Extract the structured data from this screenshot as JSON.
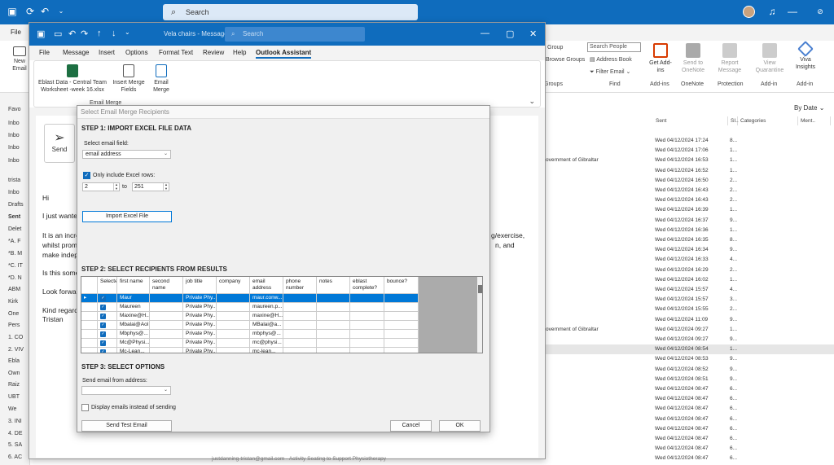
{
  "app": {
    "search_placeholder": "Search",
    "menu_file": "File"
  },
  "main_ribbon": {
    "new_email": "New Email",
    "group": "Group",
    "browse_groups": "Browse Groups",
    "groups_label": "Groups",
    "search_people": "Search People",
    "address_book": "Address Book",
    "filter_email": "Filter Email",
    "find_label": "Find",
    "get_addins": "Get Add-ins",
    "addins_label": "Add-ins",
    "send_to_onenote": "Send to OneNote",
    "onenote_label": "OneNote",
    "report_message": "Report Message",
    "protection_label": "Protection",
    "view_quarantine": "View Quarantine",
    "addin_label": "Add-in",
    "viva_insights": "Viva Insights",
    "addin2_label": "Add-in"
  },
  "left_pane": {
    "items": [
      "Favo",
      "Inbo",
      "Inbo",
      "Inbo",
      "Inbo",
      "trista",
      "Inbo",
      "Drafts",
      "Sent",
      "Delet",
      "*A. F",
      "*B. M",
      "*C. IT",
      "*D. N",
      "ABM",
      "Kirk",
      "One",
      "Pers",
      "1. CO",
      "2. VIV",
      "Ebla",
      "Own",
      "Raiz",
      "UBT",
      "We",
      "3. INI",
      "4. DE",
      "5. SA",
      "6. AC",
      "7. CO"
    ]
  },
  "mail_list": {
    "sort": "By Date",
    "columns": [
      "Sent",
      "SI..",
      "Categories",
      "Ment.."
    ],
    "rows": [
      {
        "from": "",
        "date": "Wed 04/12/2024 17:24",
        "size": "8..."
      },
      {
        "from": "",
        "date": "Wed 04/12/2024 17:06",
        "size": "1..."
      },
      {
        "from": "overnment of Gibraltar",
        "date": "Wed 04/12/2024 16:53",
        "size": "1..."
      },
      {
        "from": "",
        "date": "Wed 04/12/2024 16:52",
        "size": "1..."
      },
      {
        "from": "",
        "date": "Wed 04/12/2024 16:50",
        "size": "2..."
      },
      {
        "from": "",
        "date": "Wed 04/12/2024 16:43",
        "size": "2..."
      },
      {
        "from": "",
        "date": "Wed 04/12/2024 16:43",
        "size": "2..."
      },
      {
        "from": "",
        "date": "Wed 04/12/2024 16:39",
        "size": "1..."
      },
      {
        "from": "",
        "date": "Wed 04/12/2024 16:37",
        "size": "9..."
      },
      {
        "from": "",
        "date": "Wed 04/12/2024 16:36",
        "size": "1..."
      },
      {
        "from": "",
        "date": "Wed 04/12/2024 16:35",
        "size": "8..."
      },
      {
        "from": "",
        "date": "Wed 04/12/2024 16:34",
        "size": "9..."
      },
      {
        "from": "",
        "date": "Wed 04/12/2024 16:33",
        "size": "4..."
      },
      {
        "from": "",
        "date": "Wed 04/12/2024 16:29",
        "size": "2..."
      },
      {
        "from": "",
        "date": "Wed 04/12/2024 16:02",
        "size": "1..."
      },
      {
        "from": "",
        "date": "Wed 04/12/2024 15:57",
        "size": "4..."
      },
      {
        "from": "",
        "date": "Wed 04/12/2024 15:57",
        "size": "3..."
      },
      {
        "from": "",
        "date": "Wed 04/12/2024 15:55",
        "size": "2..."
      },
      {
        "from": "",
        "date": "Wed 04/12/2024 11:09",
        "size": "9..."
      },
      {
        "from": "overnment of Gibraltar",
        "date": "Wed 04/12/2024 09:27",
        "size": "1..."
      },
      {
        "from": "",
        "date": "Wed 04/12/2024 09:27",
        "size": "9..."
      },
      {
        "from": "",
        "date": "Wed 04/12/2024 08:54",
        "size": "1..."
      },
      {
        "from": "",
        "date": "Wed 04/12/2024 08:53",
        "size": "9..."
      },
      {
        "from": "",
        "date": "Wed 04/12/2024 08:52",
        "size": "9..."
      },
      {
        "from": "",
        "date": "Wed 04/12/2024 08:51",
        "size": "9..."
      },
      {
        "from": "",
        "date": "Wed 04/12/2024 08:47",
        "size": "6..."
      },
      {
        "from": "",
        "date": "Wed 04/12/2024 08:47",
        "size": "6..."
      },
      {
        "from": "",
        "date": "Wed 04/12/2024 08:47",
        "size": "6..."
      },
      {
        "from": "",
        "date": "Wed 04/12/2024 08:47",
        "size": "6..."
      },
      {
        "from": "",
        "date": "Wed 04/12/2024 08:47",
        "size": "6..."
      },
      {
        "from": "",
        "date": "Wed 04/12/2024 08:47",
        "size": "6..."
      },
      {
        "from": "",
        "date": "Wed 04/12/2024 08:47",
        "size": "6..."
      },
      {
        "from": "",
        "date": "Wed 04/12/2024 08:47",
        "size": "6..."
      },
      {
        "from": "",
        "date": "Wed 04/12/2024 08:47",
        "size": "6..."
      },
      {
        "from": "",
        "date": "Wed 04/12/2024 08:47",
        "size": "6..."
      }
    ]
  },
  "message": {
    "title": "Vela chairs - Message (H...",
    "search_placeholder": "Search",
    "tabs": [
      "File",
      "Message",
      "Insert",
      "Options",
      "Format Text",
      "Review",
      "Help",
      "Outlook Assistant"
    ],
    "ribbon": {
      "eblast_data": "Eblast Data - Central Team Worksheet -week 16.xlsx",
      "insert_merge_fields": "Insert Merge Fields",
      "email_merge": "Email Merge",
      "group_label": "Email Merge"
    },
    "send": "Send",
    "body": {
      "greeting": "Hi",
      "line1": "I just wante",
      "line2": "It is an incre",
      "line2_right": "g/exercise,",
      "line3": "whilst prom",
      "line3_right": "n, and",
      "line4": "make indep",
      "line5": "Is this some",
      "line6": "Look forwa",
      "line7": "Kind regard",
      "line8": "Tristan",
      "footer": "justdanning-tristan@gmail.com - Activity Seating to Support Physiotherapy"
    }
  },
  "dialog": {
    "title": "Select Email Merge Recipients",
    "step1": "STEP 1: IMPORT EXCEL FILE DATA",
    "select_email_field": "Select email field:",
    "email_field_value": "email address",
    "only_include": "Only include Excel rows:",
    "row_from": "2",
    "to_label": "to",
    "row_to": "251",
    "import_button": "Import Excel File",
    "step2": "STEP 2: SELECT RECIPIENTS FROM RESULTS",
    "grid": {
      "headers": [
        "Selecte",
        "first name",
        "second name",
        "job title",
        "company",
        "email address",
        "phone number",
        "notes",
        "eblast complete?",
        "bounce?"
      ],
      "rows": [
        {
          "first": "Maur",
          "job": "Private Phy...",
          "email": "maur.conw..."
        },
        {
          "first": "Maureen",
          "job": "Private Phy...",
          "email": "maureen.p..."
        },
        {
          "first": "Maxine@H...",
          "job": "Private Phy...",
          "email": "maxine@H..."
        },
        {
          "first": "Mbalai@Aol",
          "job": "Private Phy...",
          "email": "MBalai@a..."
        },
        {
          "first": "Mbphys@...",
          "job": "Private Phy...",
          "email": "mbphys@..."
        },
        {
          "first": "Mc@Physi...",
          "job": "Private Phy...",
          "email": "mc@physi..."
        },
        {
          "first": "Mc-Lean...",
          "job": "Private Phy...",
          "email": "mc-lean..."
        }
      ]
    },
    "step3": "STEP 3: SELECT OPTIONS",
    "send_from": "Send email from address:",
    "display_emails": "Display emails instead of sending",
    "send_test": "Send Test Email",
    "cancel": "Cancel",
    "ok": "OK"
  },
  "colors": {
    "accent": "#0f6cbd",
    "selection": "#0078d7"
  }
}
